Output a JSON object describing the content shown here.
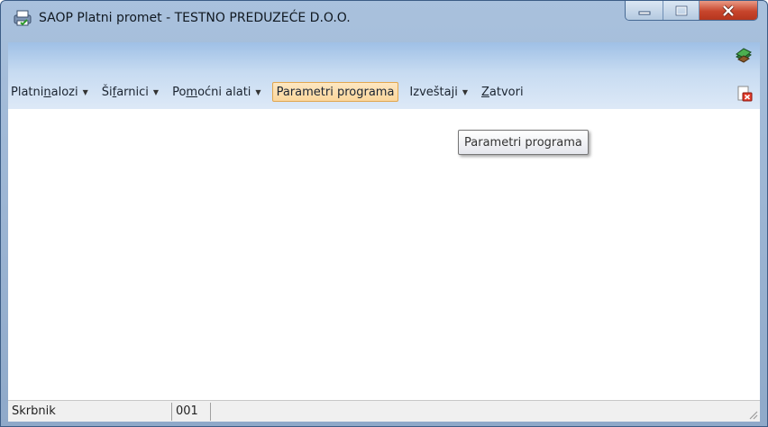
{
  "window": {
    "title": "SAOP  Platni promet - TESTNO PREDUZEĆE D.O.O.",
    "app_icon": "printer-check-icon",
    "controls": [
      "minimize-icon",
      "maximize-icon",
      "close-icon"
    ]
  },
  "menu": {
    "items": [
      {
        "pre": "Platni ",
        "u": "n",
        "post": "alozi",
        "dropdown": true
      },
      {
        "pre": "Ši",
        "u": "f",
        "post": "arnici",
        "dropdown": true
      },
      {
        "pre": "Po",
        "u": "m",
        "post": "oćni alati",
        "dropdown": true
      },
      {
        "pre": "Parametri programa",
        "u": "",
        "post": "",
        "dropdown": false,
        "active": true
      },
      {
        "pre": "Izveštaji",
        "u": "",
        "post": "",
        "dropdown": true
      },
      {
        "pre": "",
        "u": "Z",
        "post": "atvori",
        "dropdown": false
      }
    ],
    "right_icons": [
      "books-icon",
      "exit-icon"
    ]
  },
  "tooltip": {
    "text": "Parametri programa"
  },
  "statusbar": {
    "user": "Skrbnik",
    "code": "001",
    "rest": ""
  },
  "colors": {
    "accent": "#fbd79c",
    "menubar": "#c7dbf1",
    "titlebar": "#a9c1dd",
    "close": "#c7452c"
  }
}
